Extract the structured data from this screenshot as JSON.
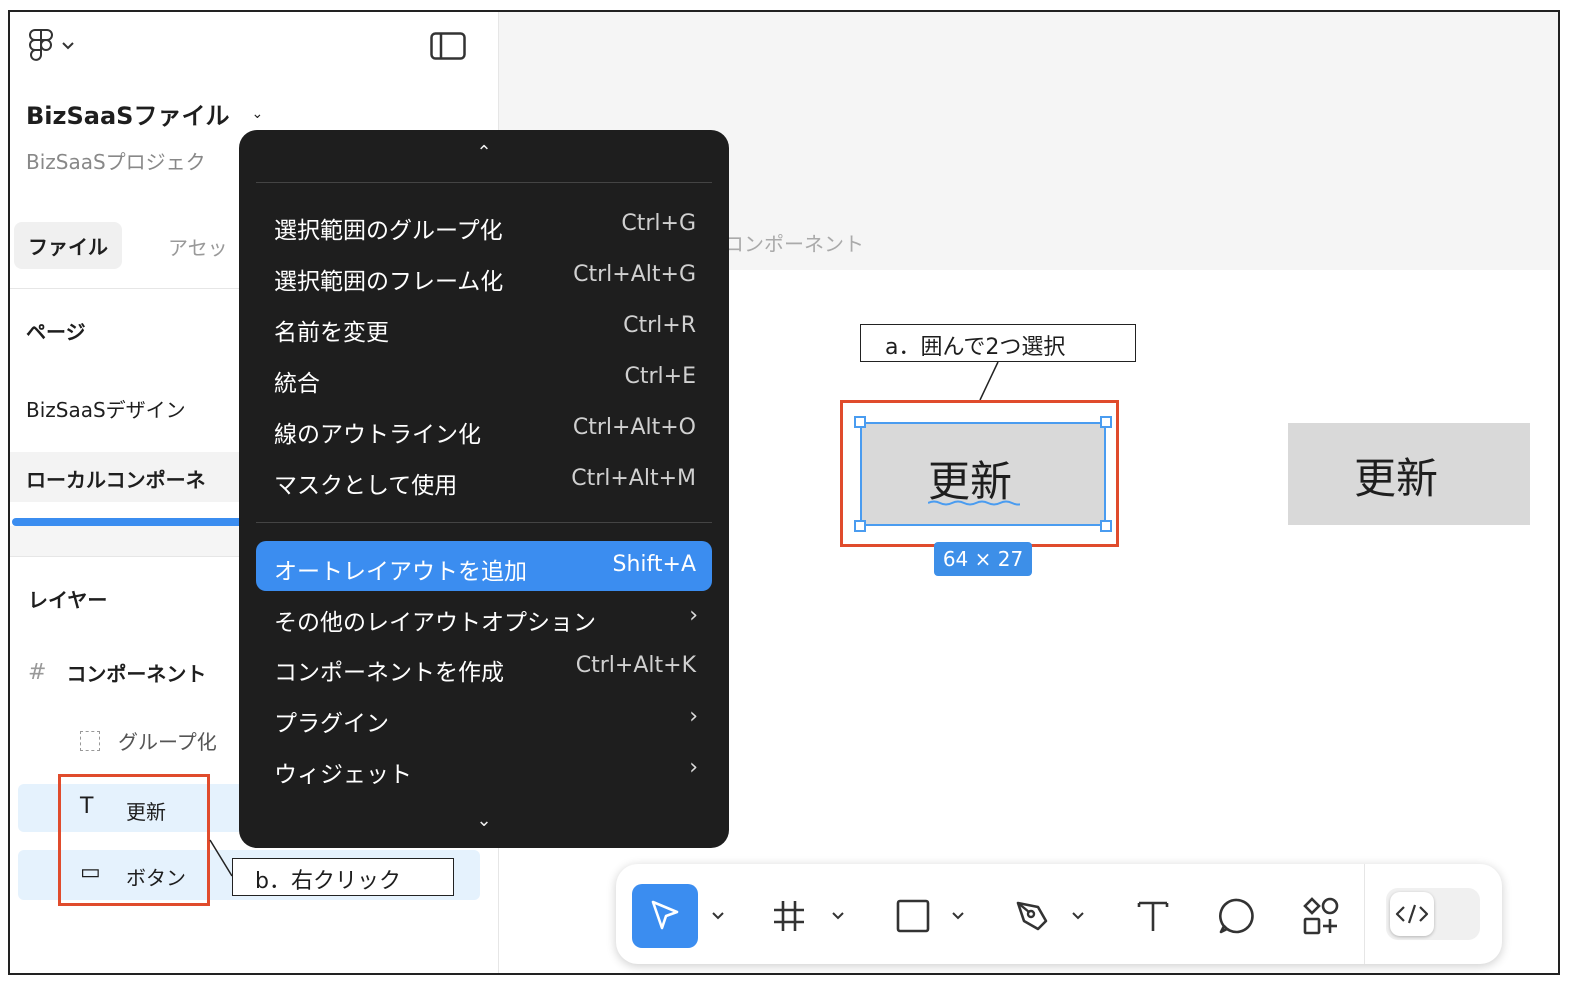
{
  "sidebar": {
    "file_title": "BizSaaSファイル",
    "project_name": "BizSaaSプロジェク",
    "tabs": [
      {
        "label": "ファイル"
      },
      {
        "label": "アセッ"
      }
    ],
    "pages_header": "ページ",
    "pages": [
      {
        "label": "BizSaaSデザイン"
      },
      {
        "label": "ローカルコンポーネ"
      }
    ],
    "layers_header": "レイヤー",
    "layers": [
      {
        "label": "コンポーネント"
      },
      {
        "label": "グループ化"
      },
      {
        "label": "更新"
      },
      {
        "label": "ボタン"
      }
    ]
  },
  "canvas": {
    "header_label": "コンポーネント",
    "selected_button_text": "更新",
    "size_badge": "64 × 27",
    "plain_button_text": "更新"
  },
  "annotations": {
    "a": "a．囲んで2つ選択",
    "b": "b．右クリック"
  },
  "context_menu": {
    "group1": [
      {
        "label": "選択範囲のグループ化",
        "shortcut": "Ctrl+G"
      },
      {
        "label": "選択範囲のフレーム化",
        "shortcut": "Ctrl+Alt+G"
      },
      {
        "label": "名前を変更",
        "shortcut": "Ctrl+R"
      },
      {
        "label": "統合",
        "shortcut": "Ctrl+E"
      },
      {
        "label": "線のアウトライン化",
        "shortcut": "Ctrl+Alt+O"
      },
      {
        "label": "マスクとして使用",
        "shortcut": "Ctrl+Alt+M"
      }
    ],
    "group2": [
      {
        "label": "オートレイアウトを追加",
        "shortcut": "Shift+A"
      },
      {
        "label": "その他のレイアウトオプション",
        "shortcut": "›"
      },
      {
        "label": "コンポーネントを作成",
        "shortcut": "Ctrl+Alt+K"
      },
      {
        "label": "プラグイン",
        "shortcut": "›"
      },
      {
        "label": "ウィジェット",
        "shortcut": "›"
      }
    ]
  },
  "colors": {
    "accent": "#3b8df0",
    "annotation_red": "#e04b2c",
    "menu_bg": "#1e1e1e"
  }
}
